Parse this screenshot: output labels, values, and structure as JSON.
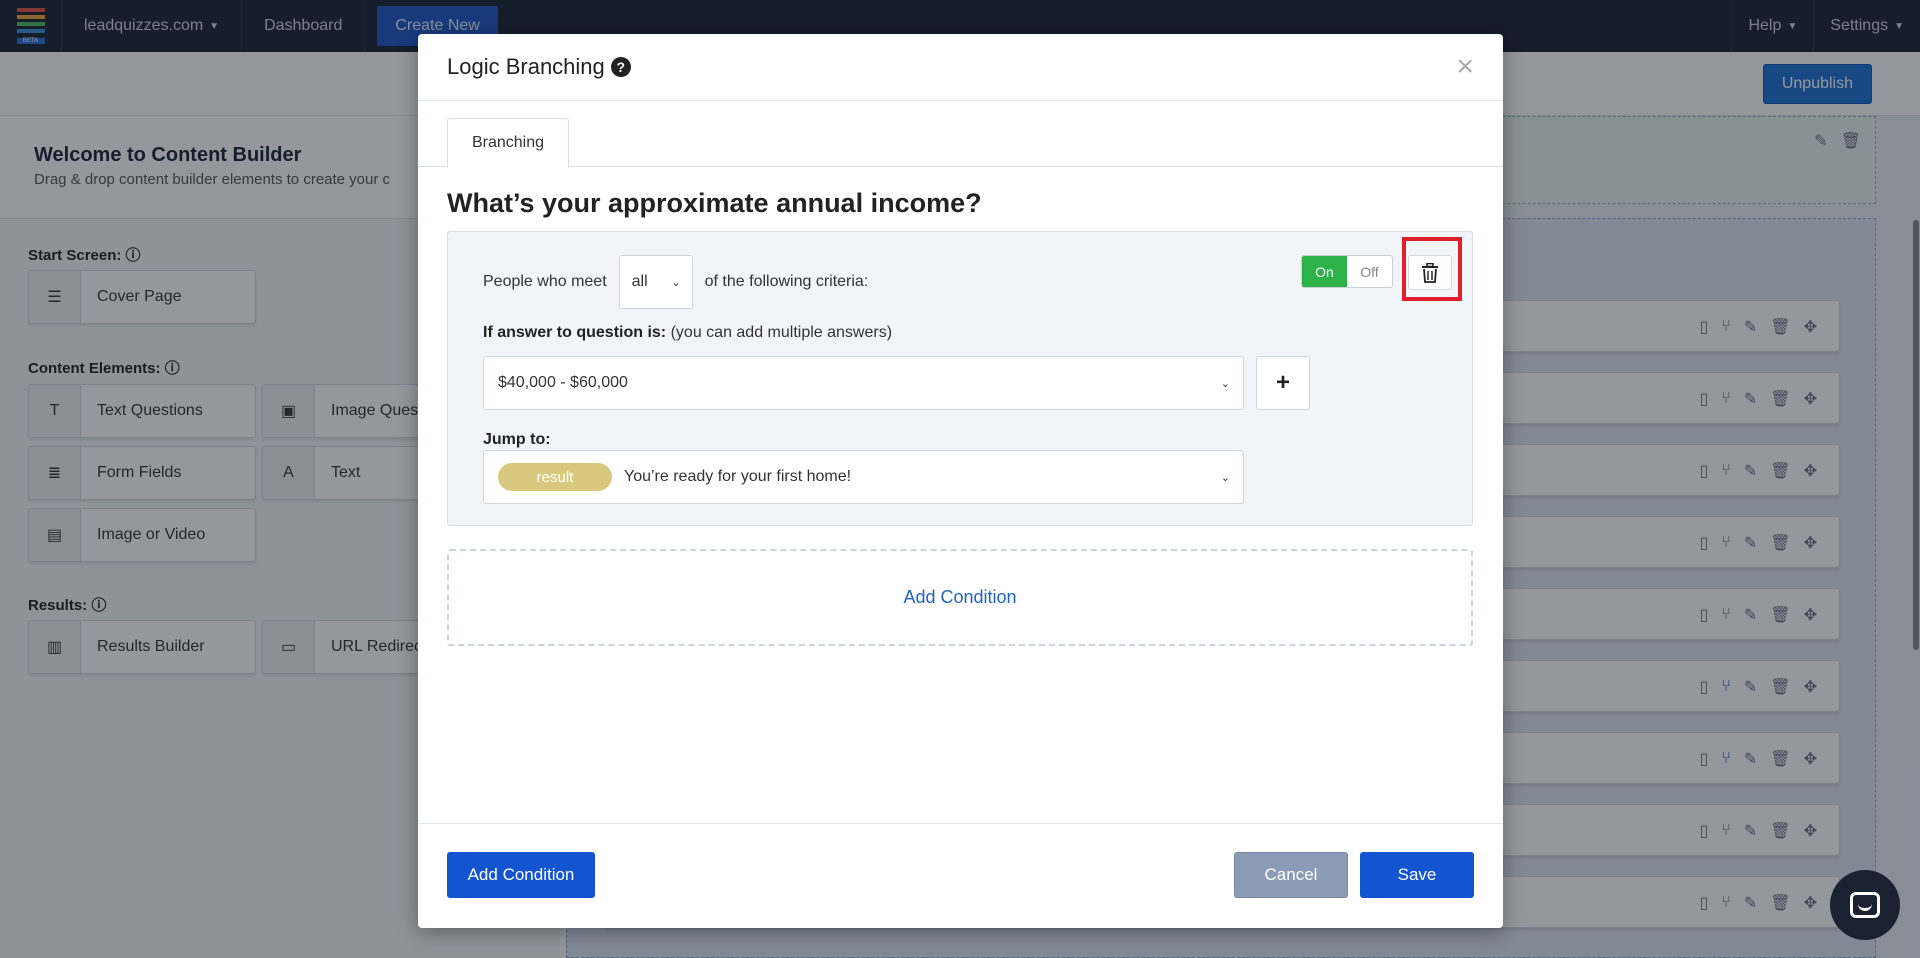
{
  "topbar": {
    "site": "leadquizzes.com",
    "dashboard": "Dashboard",
    "create_new": "Create New",
    "help": "Help",
    "settings": "Settings",
    "logo_badge": "BETA",
    "logo_colors": [
      "#e4513b",
      "#f2a531",
      "#4dbb63",
      "#3e8ee0"
    ]
  },
  "subbar": {
    "unpublish": "Unpublish"
  },
  "builder": {
    "title": "Welcome to Content Builder",
    "subtitle": "Drag & drop content builder elements to create your c",
    "start_screen": "Start Screen:",
    "content_elements": "Content Elements:",
    "results": "Results:",
    "items": {
      "cover": "Cover Page",
      "text_questions": "Text Questions",
      "image_questions": "Image Quest",
      "form_fields": "Form Fields",
      "text": "Text",
      "image_video": "Image or Video",
      "results_builder": "Results Builder",
      "url_redirect": "URL Redirec"
    }
  },
  "modal": {
    "title": "Logic Branching",
    "tab": "Branching",
    "question": "What’s your approximate annual income?",
    "rule": {
      "prefix": "People who meet",
      "match": "all",
      "suffix": "of the following criteria:",
      "toggle_on": "On",
      "toggle_off": "Off",
      "answer_label_bold": "If answer to question is:",
      "answer_label_hint": "(you can add multiple answers)",
      "answer_value": "$40,000 - $60,000",
      "jump_label": "Jump to:",
      "jump_badge": "result",
      "jump_value": "You’re ready for your first home!"
    },
    "add_condition_dashed": "Add Condition",
    "footer": {
      "add_condition": "Add Condition",
      "cancel": "Cancel",
      "save": "Save"
    }
  },
  "colors": {
    "primary": "#1355d1",
    "toggle_on": "#2db24a",
    "highlight": "#e01e2e",
    "badge": "#d9c97e"
  }
}
